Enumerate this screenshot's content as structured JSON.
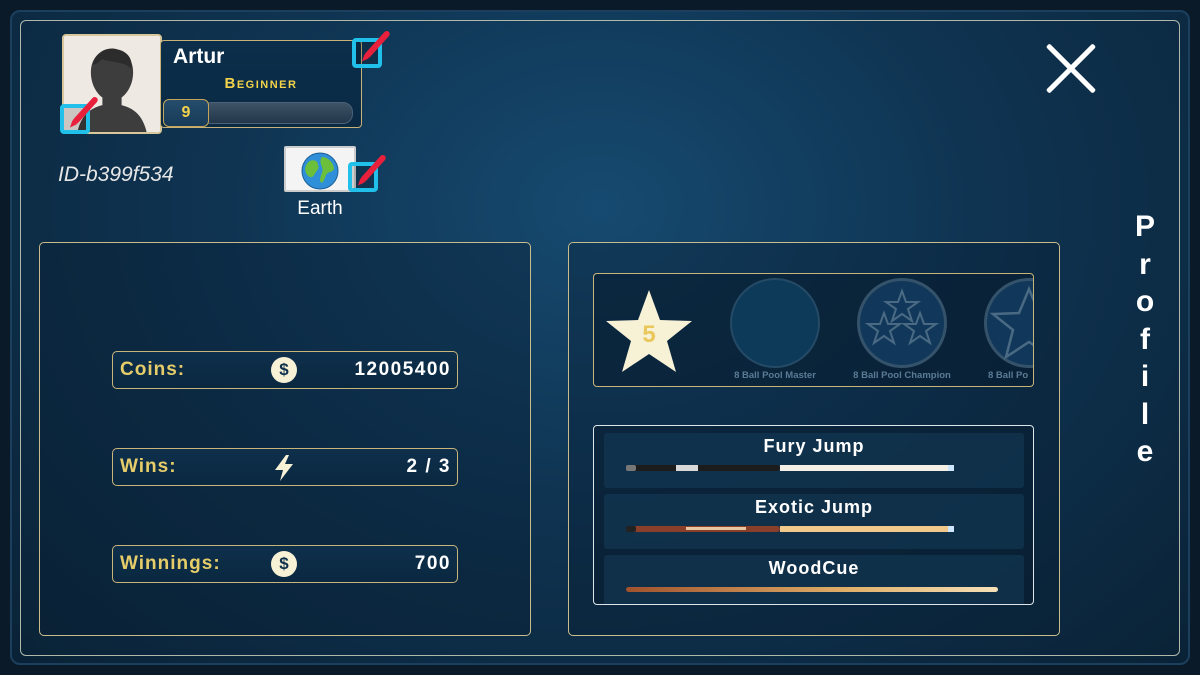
{
  "player": {
    "name": "Artur",
    "rank": "Beginner",
    "level": "9",
    "xp_progress": 0.0,
    "id": "ID-b399f534",
    "country": "Earth"
  },
  "page_title": "Profile",
  "stats": [
    {
      "label": "Coins:",
      "icon": "dollar-coin-icon",
      "value": "12005400"
    },
    {
      "label": "Wins:",
      "icon": "lightning-icon",
      "value": "2 / 3"
    },
    {
      "label": "Winnings:",
      "icon": "dollar-coin-icon",
      "value": "700"
    }
  ],
  "achievements": {
    "star_count": "5",
    "items": [
      {
        "label": "8 Ball Pool Master"
      },
      {
        "label": "8 Ball Pool Champion"
      },
      {
        "label": "8 Ball Po"
      }
    ]
  },
  "cues": [
    {
      "name": "Fury Jump"
    },
    {
      "name": "Exotic Jump"
    },
    {
      "name": "WoodCue"
    }
  ],
  "colors": {
    "accent_gold": "#e6cd6a",
    "edit_blue": "#21c0ea",
    "edit_red": "#e8203c"
  }
}
